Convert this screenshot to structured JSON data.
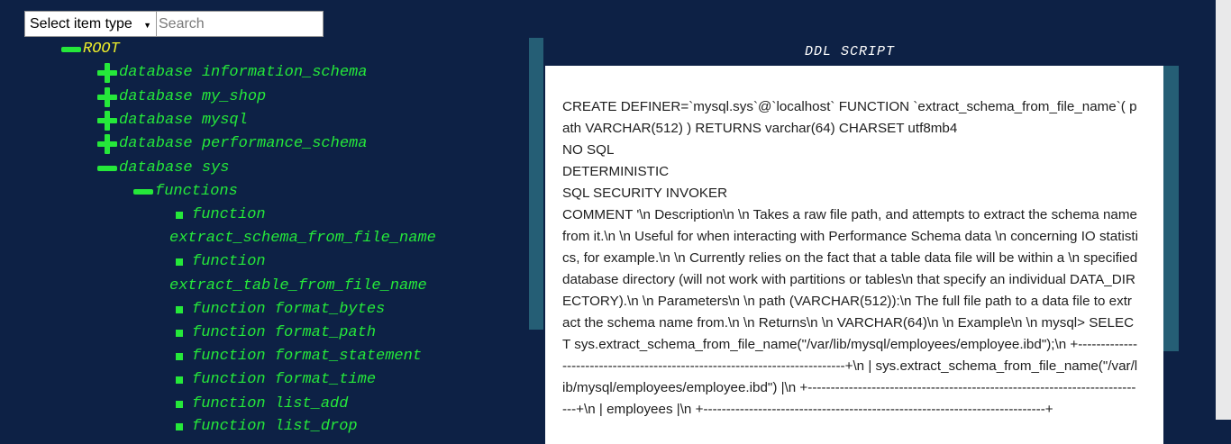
{
  "toolbar": {
    "select_value": "Select item type",
    "search_placeholder": "Search"
  },
  "tree": {
    "root": "ROOT",
    "databases": [
      "database information_schema",
      "database my_shop",
      "database mysql",
      "database performance_schema",
      "database sys"
    ],
    "functions_label": "functions",
    "functions": [
      "function",
      "extract_schema_from_file_name",
      "function",
      "extract_table_from_file_name",
      "function format_bytes",
      "function format_path",
      "function format_statement",
      "function format_time",
      "function list_add",
      "function list_drop"
    ]
  },
  "ddl": {
    "title": "DDL SCRIPT",
    "script": "CREATE DEFINER=`mysql.sys`@`localhost` FUNCTION `extract_schema_from_file_name`( path VARCHAR(512) ) RETURNS varchar(64) CHARSET utf8mb4\nNO SQL\nDETERMINISTIC\nSQL SECURITY INVOKER\nCOMMENT '\\n Description\\n \\n Takes a raw file path, and attempts to extract the schema name from it.\\n \\n Useful for when interacting with Performance Schema data \\n concerning IO statistics, for example.\\n \\n Currently relies on the fact that a table data file will be within a \\n specified database directory (will not work with partitions or tables\\n that specify an individual DATA_DIRECTORY).\\n \\n Parameters\\n \\n path (VARCHAR(512)):\\n The full file path to a data file to extract the schema name from.\\n \\n Returns\\n \\n VARCHAR(64)\\n \\n Example\\n \\n mysql> SELECT sys.extract_schema_from_file_name(\"/var/lib/mysql/employees/employee.ibd\");\\n +---------------------------------------------------------------------------+\\n | sys.extract_schema_from_file_name(\"/var/lib/mysql/employees/employee.ibd\") |\\n +---------------------------------------------------------------------------+\\n | employees |\\n +---------------------------------------------------------------------------+"
  },
  "colors": {
    "background": "#0d2145",
    "tree_text": "#25e83a",
    "root_text": "#eded2a",
    "panel_strip": "#255e75"
  }
}
